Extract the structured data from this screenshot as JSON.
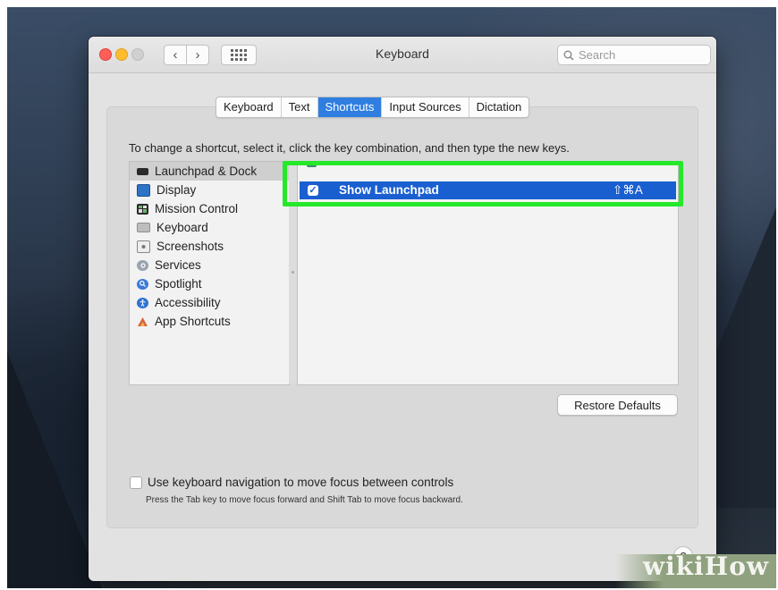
{
  "window": {
    "title": "Keyboard"
  },
  "toolbar": {
    "back_glyph": "‹",
    "forward_glyph": "›",
    "search_placeholder": "Search"
  },
  "tabs": [
    {
      "label": "Keyboard",
      "active": false
    },
    {
      "label": "Text",
      "active": false
    },
    {
      "label": "Shortcuts",
      "active": true
    },
    {
      "label": "Input Sources",
      "active": false
    },
    {
      "label": "Dictation",
      "active": false
    }
  ],
  "instructions": "To change a shortcut, select it, click the key combination, and then type the new keys.",
  "categories": [
    {
      "label": "Launchpad & Dock",
      "icon": "launchpad-dock-icon",
      "selected": true
    },
    {
      "label": "Display",
      "icon": "display-icon",
      "selected": false
    },
    {
      "label": "Mission Control",
      "icon": "mission-control-icon",
      "selected": false
    },
    {
      "label": "Keyboard",
      "icon": "keyboard-icon",
      "selected": false
    },
    {
      "label": "Screenshots",
      "icon": "screenshots-icon",
      "selected": false
    },
    {
      "label": "Services",
      "icon": "services-icon",
      "selected": false
    },
    {
      "label": "Spotlight",
      "icon": "spotlight-icon",
      "selected": false
    },
    {
      "label": "Accessibility",
      "icon": "accessibility-icon",
      "selected": false
    },
    {
      "label": "App Shortcuts",
      "icon": "app-shortcuts-icon",
      "selected": false
    }
  ],
  "shortcuts": {
    "selected": {
      "label": "Show Launchpad",
      "keys": "⇧⌘A",
      "checked": true
    }
  },
  "restore_defaults": "Restore Defaults",
  "keyboard_nav": {
    "label": "Use keyboard navigation to move focus between controls",
    "hint": "Press the Tab key to move focus forward and Shift Tab to move focus backward.",
    "checked": false
  },
  "help": "?",
  "watermark": "wikiHow",
  "colors": {
    "selection_blue": "#1a5fd0",
    "tab_active": "#2f7ee0",
    "highlight_green": "#26e82a"
  }
}
